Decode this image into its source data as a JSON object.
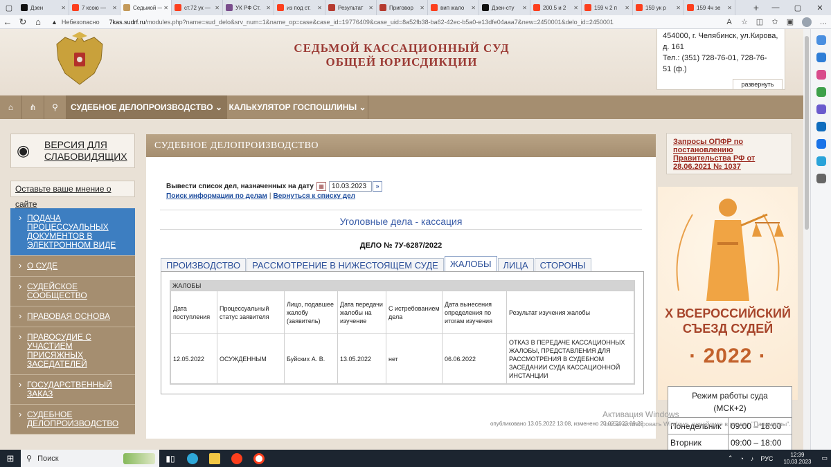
{
  "browser": {
    "tabs": [
      {
        "title": "Дзен",
        "color": "#111111",
        "active": false
      },
      {
        "title": "7 ксою —",
        "color": "#fc3f1d",
        "active": false
      },
      {
        "title": "Седьмой —",
        "color": "#c49a5a",
        "active": true
      },
      {
        "title": "ст.72 ук —",
        "color": "#fc3f1d",
        "active": false
      },
      {
        "title": "УК РФ Ст.",
        "color": "#7a4d8c",
        "active": false
      },
      {
        "title": "из под ст.",
        "color": "#fc3f1d",
        "active": false
      },
      {
        "title": "Результат",
        "color": "#b53a2f",
        "active": false
      },
      {
        "title": "Приговор",
        "color": "#b53a2f",
        "active": false
      },
      {
        "title": "вип жало",
        "color": "#fc3f1d",
        "active": false
      },
      {
        "title": "Дзен-сту",
        "color": "#111111",
        "active": false
      },
      {
        "title": "200.5 и 2",
        "color": "#fc3f1d",
        "active": false
      },
      {
        "title": "159 ч 2 п",
        "color": "#fc3f1d",
        "active": false
      },
      {
        "title": "159 ук р",
        "color": "#fc3f1d",
        "active": false
      },
      {
        "title": "159 4ч зе",
        "color": "#fc3f1d",
        "active": false
      }
    ],
    "security_label": "Небезопасно",
    "url_host": "7kas.sudrf.ru",
    "url_path": "/modules.php?name=sud_delo&srv_num=1&name_op=case&case_id=19776409&case_uid=8a52fb38-ba62-42ec-b5a0-e13dfe04aaa7&new=2450001&delo_id=2450001"
  },
  "header": {
    "court_line1": "СЕДЬМОЙ КАССАЦИОННЫЙ СУД",
    "court_line2": "ОБЩЕЙ ЮРИСДИКЦИИ",
    "contact_lines": [
      "454000, г. Челябинск, ул.Кирова,",
      "д. 161",
      "Тел.: (351) 728-76-01, 728-76-",
      "51 (ф.)"
    ],
    "expand_label": "развернуть"
  },
  "nav": {
    "items": [
      "СУДЕБНОЕ ДЕЛОПРОИЗВОДСТВО ⌄",
      "КАЛЬКУЛЯТОР ГОСПОШЛИНЫ ⌄"
    ]
  },
  "left": {
    "vision_label_1": "ВЕРСИЯ ДЛЯ",
    "vision_label_2": "СЛАБОВИДЯЩИХ",
    "feedback_label": "Оставьте ваше мнение о сайте",
    "menu": [
      "ПОДАЧА ПРОЦЕССУАЛЬНЫХ ДОКУМЕНТОВ В ЭЛЕКТРОННОМ ВИДЕ",
      "О СУДЕ",
      "СУДЕЙСКОЕ СООБЩЕСТВО",
      "ПРАВОВАЯ ОСНОВА",
      "ПРАВОСУДИЕ С УЧАСТИЕМ ПРИСЯЖНЫХ ЗАСЕДАТЕЛЕЙ",
      "ГОСУДАРСТВЕННЫЙ ЗАКАЗ",
      "СУДЕБНОЕ ДЕЛОПРОИЗВОДСТВО"
    ]
  },
  "content": {
    "heading": "СУДЕБНОЕ ДЕЛОПРОИЗВОДСТВО",
    "date_label": "Вывести список дел, назначенных на дату",
    "date_value": "10.03.2023",
    "search_link": "Поиск информации по делам",
    "back_link": "Вернуться к списку дел",
    "section_title": "Уголовные дела - кассация",
    "case_number": "ДЕЛО № 7У-6287/2022",
    "tabs": [
      "ПРОИЗВОДСТВО",
      "РАССМОТРЕНИЕ В НИЖЕСТОЯЩЕМ СУДЕ",
      "ЖАЛОБЫ",
      "ЛИЦА",
      "СТОРОНЫ"
    ],
    "active_tab": "ЖАЛОБЫ",
    "complaints": {
      "caption": "ЖАЛОБЫ",
      "columns": [
        "Дата поступления",
        "Процессуальный статус заявителя",
        "Лицо, подавшее жалобу (заявитель)",
        "Дата передачи жалобы на изучение",
        "С истребованием дела",
        "Дата вынесения определения по итогам изучения",
        "Результат изучения жалобы"
      ],
      "rows": [
        [
          "12.05.2022",
          "ОСУЖДЕННЫМ",
          "Буйских А. В.",
          "13.05.2022",
          "нет",
          "06.06.2022",
          "ОТКАЗ В ПЕРЕДАЧЕ КАССАЦИОННЫХ ЖАЛОБЫ, ПРЕДСТАВЛЕНИЯ ДЛЯ РАССМОТРЕНИЯ В СУДЕБНОМ ЗАСЕДАНИИ СУДА КАССАЦИОННОЙ ИНСТАНЦИИ"
        ]
      ]
    },
    "published_note": "опубликовано 13.05.2022 13:08, изменено 23.02.2023 09:29"
  },
  "right": {
    "opfr_link": "Запросы ОПФР по постановлению Правительства РФ от 28.06.2021 № 1037",
    "congress_line1": "X ВСЕРОССИЙСКИЙ",
    "congress_line2": "СЪЕЗД СУДЕЙ",
    "congress_year": "· 2022 ·",
    "hours_title_1": "Режим работы суда",
    "hours_title_2": "(МСК+2)",
    "hours": [
      {
        "day": "Понедельник",
        "time": "09:00 – 18:00"
      },
      {
        "day": "Вторник",
        "time": "09:00 – 18:00"
      }
    ]
  },
  "watermark": {
    "line1": "Активация Windows",
    "line2": "Чтобы активировать Windows, перейдите в раздел \"Параметры\"."
  },
  "taskbar": {
    "search_label": "Поиск",
    "lang": "РУС",
    "time": "12:39",
    "date": "10.03.2023"
  }
}
